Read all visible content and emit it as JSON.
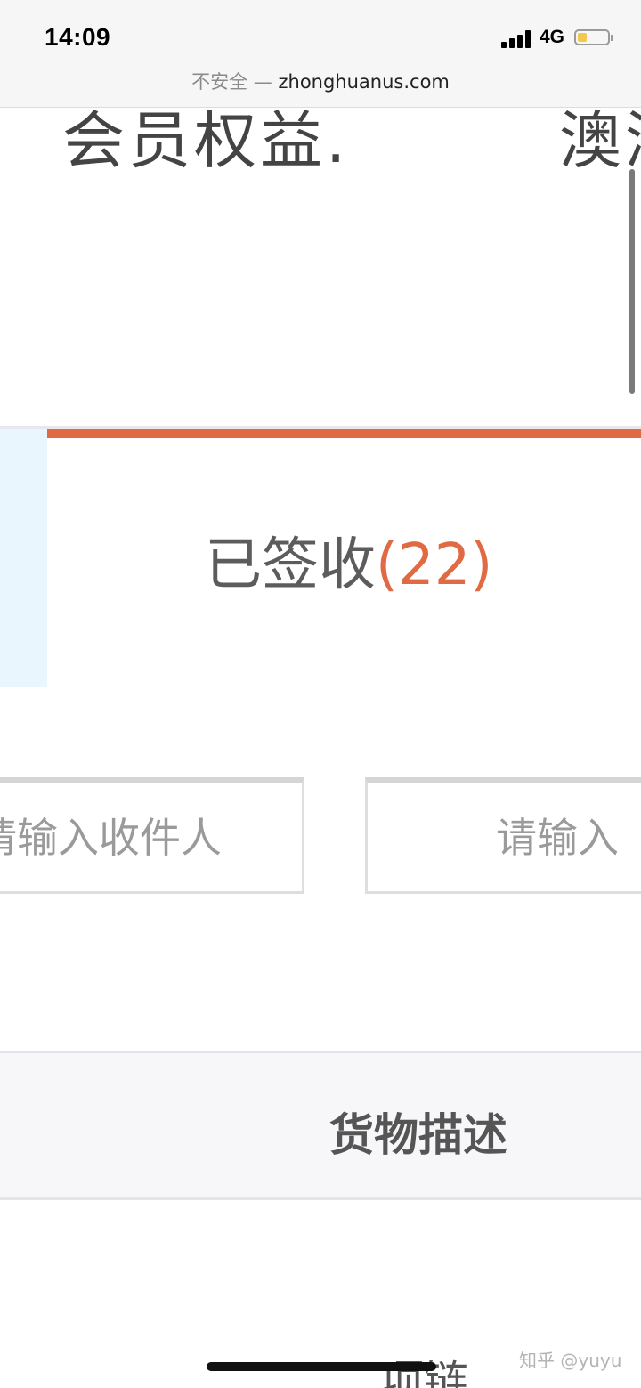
{
  "status_bar": {
    "time": "14:09",
    "network": "4G",
    "battery_level": 0.3,
    "battery_color": "#f2c94c"
  },
  "address_bar": {
    "security": "不安全",
    "separator": "—",
    "domain": "zhonghuanus.com"
  },
  "nav": {
    "left_label": "会员权益.",
    "right_label": "澳洲"
  },
  "tab": {
    "label": "已签收",
    "count": "(22)",
    "accent_color": "#e06a44"
  },
  "search": {
    "recipient_placeholder": "请输入收件人",
    "second_placeholder": "请输入"
  },
  "table": {
    "header_description": "货物描述",
    "rows": [
      {
        "description": "项链"
      }
    ]
  },
  "watermark": "知乎 @yuyu"
}
